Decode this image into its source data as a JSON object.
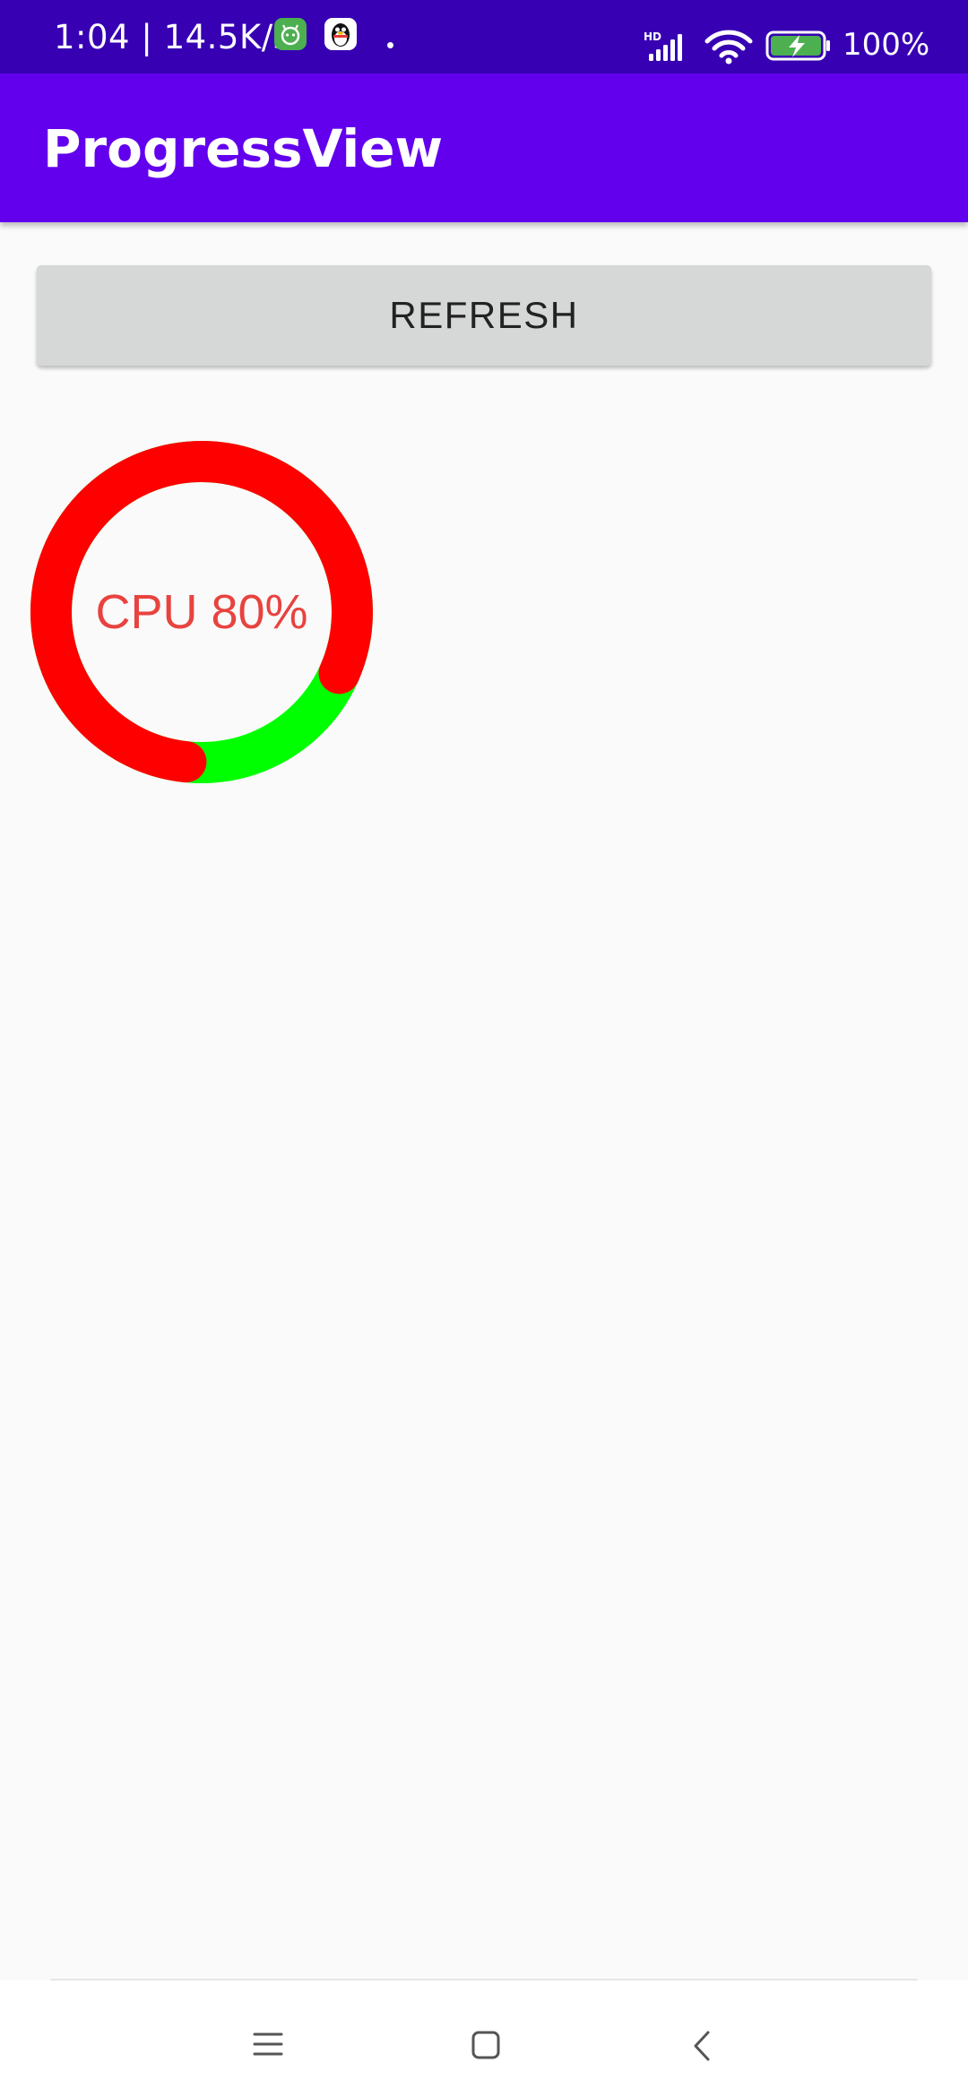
{
  "status_bar": {
    "time_and_speed": "1:04 | 14.5K/s",
    "battery_percent": "100%",
    "network_label": "HD",
    "icons": [
      "android-app-icon",
      "qq-penguin-icon",
      "signal-icon",
      "wifi-icon",
      "battery-charging-icon"
    ]
  },
  "app_bar": {
    "title": "ProgressView",
    "color": "#6200ee"
  },
  "main": {
    "refresh_label": "REFRESH",
    "progress": {
      "label": "CPU 80%",
      "value": 0.8,
      "progress_color": "#ff0000",
      "remaining_color": "#00ff00",
      "text_color": "#e8433f"
    }
  },
  "nav_bar": {
    "icons": [
      "menu-icon",
      "home-icon",
      "back-icon"
    ]
  }
}
